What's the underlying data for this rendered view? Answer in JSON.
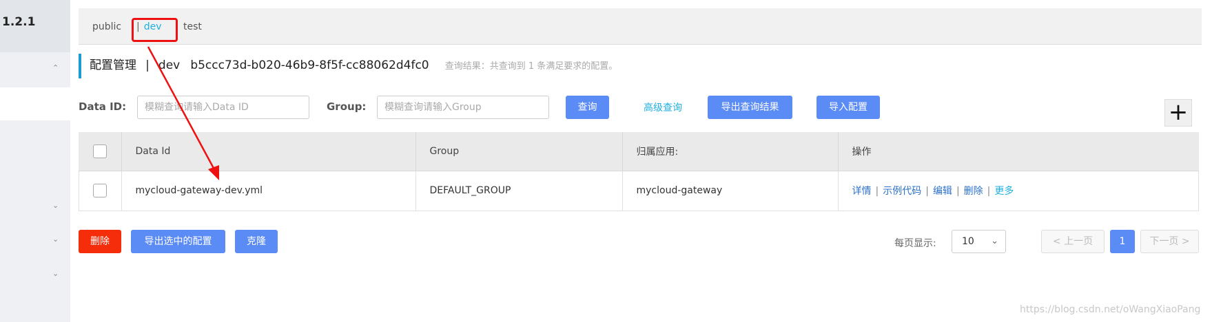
{
  "sidebar": {
    "version": "1.2.1",
    "chevrons": [
      "^",
      "v",
      "v",
      "v"
    ]
  },
  "namespaces": {
    "public": "public",
    "dev": "dev",
    "test": "test",
    "separator": "|"
  },
  "title": {
    "label": "配置管理",
    "separator": "|",
    "namespace": "dev",
    "namespace_id": "b5ccc73d-b020-46b9-8f5f-cc88062d4fc0",
    "query_result": "查询结果：共查询到 1 条满足要求的配置。"
  },
  "search": {
    "data_id_label": "Data ID:",
    "data_id_placeholder": "模糊查询请输入Data ID",
    "group_label": "Group:",
    "group_placeholder": "模糊查询请输入Group",
    "query_button": "查询",
    "advanced_query": "高级查询",
    "export_button": "导出查询结果",
    "import_button": "导入配置",
    "add_icon": "plus-icon"
  },
  "table": {
    "headers": [
      "Data Id",
      "Group",
      "归属应用:",
      "操作"
    ],
    "rows": [
      {
        "data_id": "mycloud-gateway-dev.yml",
        "group": "DEFAULT_GROUP",
        "app": "mycloud-gateway"
      }
    ],
    "ops": [
      "详情",
      "示例代码",
      "编辑",
      "删除",
      "更多"
    ]
  },
  "bottom": {
    "delete_button": "删除",
    "export_selected_button": "导出选中的配置",
    "clone_button": "克隆",
    "per_page_label": "每页显示:",
    "per_page_value": "10",
    "prev_page": "上一页",
    "current_page": "1",
    "next_page": "下一页"
  },
  "watermark": "https://blog.csdn.net/oWangXiaoPang",
  "colors": {
    "primary": "#5b8bf4",
    "danger": "#f52d0a",
    "accent": "#1fb0e0",
    "highlight": "#e11111"
  }
}
